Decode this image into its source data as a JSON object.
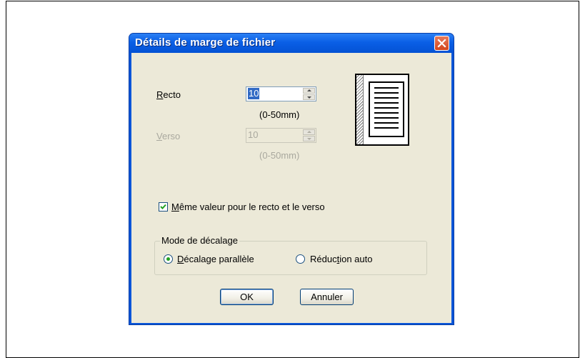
{
  "dialog": {
    "title": "Détails de marge de fichier"
  },
  "recto": {
    "label_underline": "R",
    "label_rest": "ecto",
    "value": "10",
    "range": "(0-50mm)"
  },
  "verso": {
    "label_underline": "V",
    "label_rest": "erso",
    "value": "10",
    "range": "(0-50mm)",
    "enabled": false
  },
  "same_value": {
    "label_underline": "M",
    "label_rest": "ême valeur pour le recto et le verso",
    "checked": true
  },
  "mode": {
    "group_title": "Mode de décalage",
    "parallel": {
      "label_underline": "D",
      "label_rest": "écalage parallèle",
      "selected": true
    },
    "auto": {
      "label_pre": "Réduc",
      "label_underline": "t",
      "label_rest": "ion auto",
      "selected": false
    }
  },
  "buttons": {
    "ok": "OK",
    "cancel": "Annuler"
  },
  "icons": {
    "close": "close-icon",
    "preview": "page-margin-preview-icon"
  }
}
